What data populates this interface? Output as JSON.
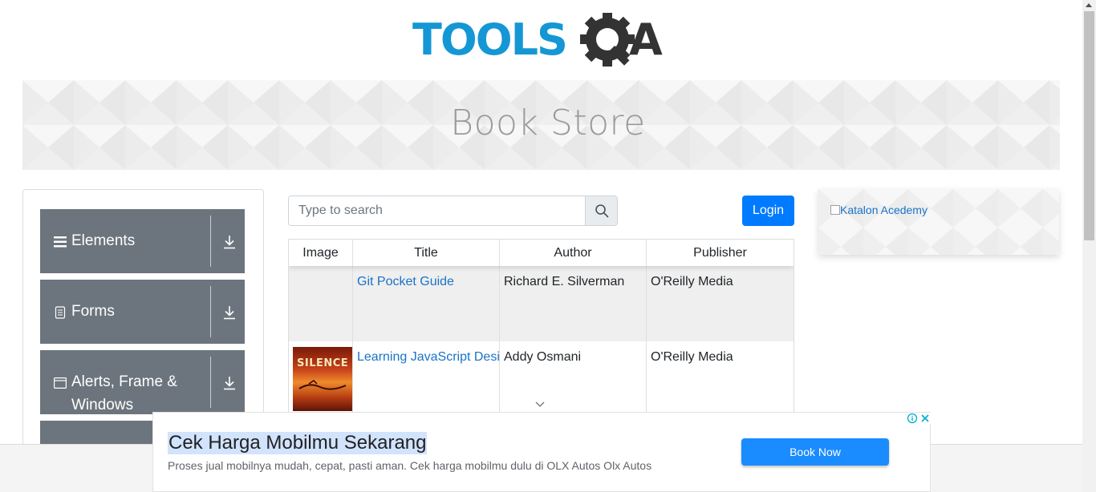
{
  "header": {
    "logo_text": "TOOLSQA"
  },
  "banner": {
    "title": "Book Store"
  },
  "left_menu": {
    "groups": [
      {
        "label": "Elements",
        "icon": "menu-icon"
      },
      {
        "label": "Forms",
        "icon": "document-icon"
      },
      {
        "label": "Alerts, Frame &",
        "label_line2": "Windows",
        "icon": "window-icon"
      },
      {
        "label": "",
        "icon": ""
      }
    ]
  },
  "search": {
    "placeholder": "Type to search",
    "icon": "search-icon"
  },
  "login": {
    "label": "Login"
  },
  "table": {
    "columns": [
      "Image",
      "Title",
      "Author",
      "Publisher"
    ],
    "rows": [
      {
        "image": "",
        "title": "Git Pocket Guide",
        "author": "Richard E. Silverman",
        "publisher": "O'Reilly Media"
      },
      {
        "image": "book cover",
        "cover_text": "SILENCE",
        "title": "Learning JavaScript Design Patterns",
        "author": "Addy Osmani",
        "publisher": "O'Reilly Media"
      }
    ]
  },
  "right_ad": {
    "alt_text": "Katalon Acedemy"
  },
  "bottom_ad": {
    "title": "Cek Harga Mobilmu Sekarang",
    "description": "Proses jual mobilnya mudah, cepat, pasti aman. Cek harga mobilmu dulu di OLX Autos Olx Autos",
    "button_label": "Book Now"
  },
  "colors": {
    "primary": "#007bff",
    "menu_group": "#6c757d",
    "logo_blue": "#1497d4",
    "logo_dark": "#333333",
    "link": "#1a73c8"
  }
}
